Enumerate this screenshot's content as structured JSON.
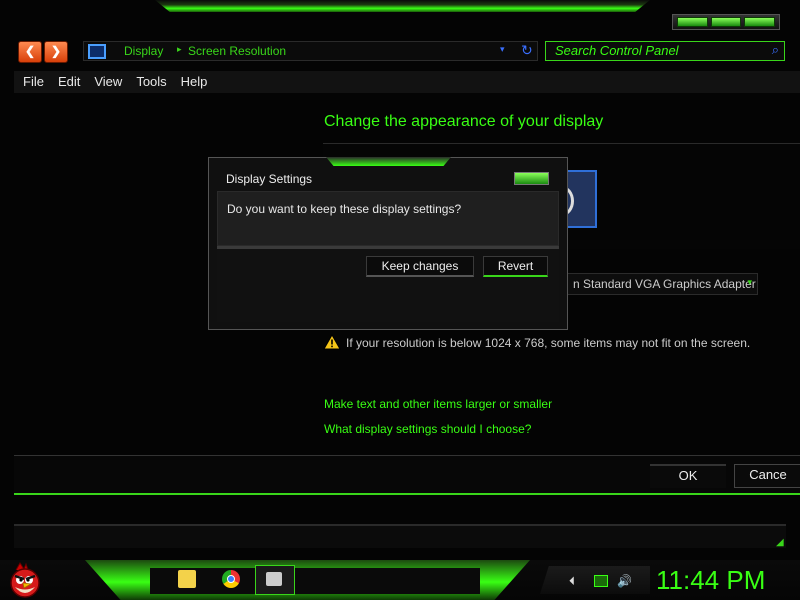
{
  "address": {
    "back_glyph": "❮",
    "forward_glyph": "❯",
    "crumbs": [
      "Display",
      "Screen Resolution"
    ],
    "separator": "▸",
    "dropdown_glyph": "▾",
    "refresh_glyph": "↻"
  },
  "search": {
    "placeholder": "Search Control Panel",
    "icon_glyph": "⌕"
  },
  "menu": {
    "items": [
      "File",
      "Edit",
      "View",
      "Tools",
      "Help"
    ]
  },
  "main": {
    "title": "Change the appearance of your display",
    "adapter": "n Standard VGA Graphics Adapter",
    "adapter_arrow": "▾",
    "warning": "If your resolution is below 1024 x 768, some items may not fit on the screen.",
    "links": [
      "Make text and other items larger or smaller",
      "What display settings should I choose?"
    ]
  },
  "footer": {
    "ok_label": "OK",
    "cancel_label": "Cance",
    "grip_glyph": "◢"
  },
  "dialog": {
    "title": "Display Settings",
    "message": "Do you want to keep these display settings?",
    "keep_label": "Keep changes",
    "revert_label": "Revert"
  },
  "taskbar": {
    "clock": "11:44 PM",
    "tray_back_glyph": "⏴",
    "tray_volume_glyph": "🔊"
  },
  "colors": {
    "accent": "#39ff14",
    "link": "#39d61a",
    "background": "#000000"
  },
  "icons": [
    "monitor-icon",
    "refresh-icon",
    "search-icon",
    "warning-icon",
    "angry-bird-start-icon",
    "folder-icon",
    "chrome-icon",
    "display-icon",
    "volume-icon"
  ]
}
